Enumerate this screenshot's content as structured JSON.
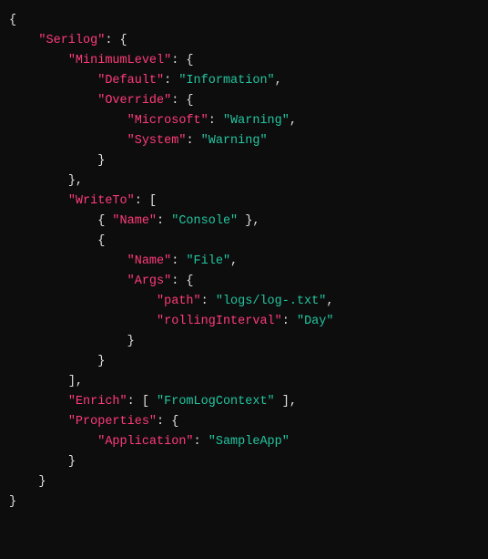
{
  "code": {
    "lines": [
      {
        "indent": 0,
        "segs": [
          {
            "c": "p",
            "t": "{"
          }
        ]
      },
      {
        "indent": 1,
        "segs": [
          {
            "c": "k",
            "t": "\"Serilog\""
          },
          {
            "c": "p",
            "t": ": {"
          }
        ]
      },
      {
        "indent": 2,
        "segs": [
          {
            "c": "k",
            "t": "\"MinimumLevel\""
          },
          {
            "c": "p",
            "t": ": {"
          }
        ]
      },
      {
        "indent": 3,
        "segs": [
          {
            "c": "k",
            "t": "\"Default\""
          },
          {
            "c": "p",
            "t": ": "
          },
          {
            "c": "s",
            "t": "\"Information\""
          },
          {
            "c": "p",
            "t": ","
          }
        ]
      },
      {
        "indent": 3,
        "segs": [
          {
            "c": "k",
            "t": "\"Override\""
          },
          {
            "c": "p",
            "t": ": {"
          }
        ]
      },
      {
        "indent": 4,
        "segs": [
          {
            "c": "k",
            "t": "\"Microsoft\""
          },
          {
            "c": "p",
            "t": ": "
          },
          {
            "c": "s",
            "t": "\"Warning\""
          },
          {
            "c": "p",
            "t": ","
          }
        ]
      },
      {
        "indent": 4,
        "segs": [
          {
            "c": "k",
            "t": "\"System\""
          },
          {
            "c": "p",
            "t": ": "
          },
          {
            "c": "s",
            "t": "\"Warning\""
          }
        ]
      },
      {
        "indent": 3,
        "segs": [
          {
            "c": "p",
            "t": "}"
          }
        ]
      },
      {
        "indent": 2,
        "segs": [
          {
            "c": "p",
            "t": "},"
          }
        ]
      },
      {
        "indent": 2,
        "segs": [
          {
            "c": "k",
            "t": "\"WriteTo\""
          },
          {
            "c": "p",
            "t": ": ["
          }
        ]
      },
      {
        "indent": 3,
        "segs": [
          {
            "c": "p",
            "t": "{ "
          },
          {
            "c": "k",
            "t": "\"Name\""
          },
          {
            "c": "p",
            "t": ": "
          },
          {
            "c": "s",
            "t": "\"Console\""
          },
          {
            "c": "p",
            "t": " },"
          }
        ]
      },
      {
        "indent": 3,
        "segs": [
          {
            "c": "p",
            "t": "{"
          }
        ]
      },
      {
        "indent": 4,
        "segs": [
          {
            "c": "k",
            "t": "\"Name\""
          },
          {
            "c": "p",
            "t": ": "
          },
          {
            "c": "s",
            "t": "\"File\""
          },
          {
            "c": "p",
            "t": ","
          }
        ]
      },
      {
        "indent": 4,
        "segs": [
          {
            "c": "k",
            "t": "\"Args\""
          },
          {
            "c": "p",
            "t": ": {"
          }
        ]
      },
      {
        "indent": 5,
        "segs": [
          {
            "c": "k",
            "t": "\"path\""
          },
          {
            "c": "p",
            "t": ": "
          },
          {
            "c": "s",
            "t": "\"logs/log-.txt\""
          },
          {
            "c": "p",
            "t": ","
          }
        ]
      },
      {
        "indent": 5,
        "segs": [
          {
            "c": "k",
            "t": "\"rollingInterval\""
          },
          {
            "c": "p",
            "t": ": "
          },
          {
            "c": "s",
            "t": "\"Day\""
          }
        ]
      },
      {
        "indent": 4,
        "segs": [
          {
            "c": "p",
            "t": "}"
          }
        ]
      },
      {
        "indent": 3,
        "segs": [
          {
            "c": "p",
            "t": "}"
          }
        ]
      },
      {
        "indent": 2,
        "segs": [
          {
            "c": "p",
            "t": "],"
          }
        ]
      },
      {
        "indent": 2,
        "segs": [
          {
            "c": "k",
            "t": "\"Enrich\""
          },
          {
            "c": "p",
            "t": ": [ "
          },
          {
            "c": "s",
            "t": "\"FromLogContext\""
          },
          {
            "c": "p",
            "t": " ],"
          }
        ]
      },
      {
        "indent": 2,
        "segs": [
          {
            "c": "k",
            "t": "\"Properties\""
          },
          {
            "c": "p",
            "t": ": {"
          }
        ]
      },
      {
        "indent": 3,
        "segs": [
          {
            "c": "k",
            "t": "\"Application\""
          },
          {
            "c": "p",
            "t": ": "
          },
          {
            "c": "s",
            "t": "\"SampleApp\""
          }
        ]
      },
      {
        "indent": 2,
        "segs": [
          {
            "c": "p",
            "t": "}"
          }
        ]
      },
      {
        "indent": 1,
        "segs": [
          {
            "c": "p",
            "t": "}"
          }
        ]
      },
      {
        "indent": 0,
        "segs": [
          {
            "c": "p",
            "t": "}"
          }
        ]
      }
    ],
    "indent_unit": "    "
  }
}
